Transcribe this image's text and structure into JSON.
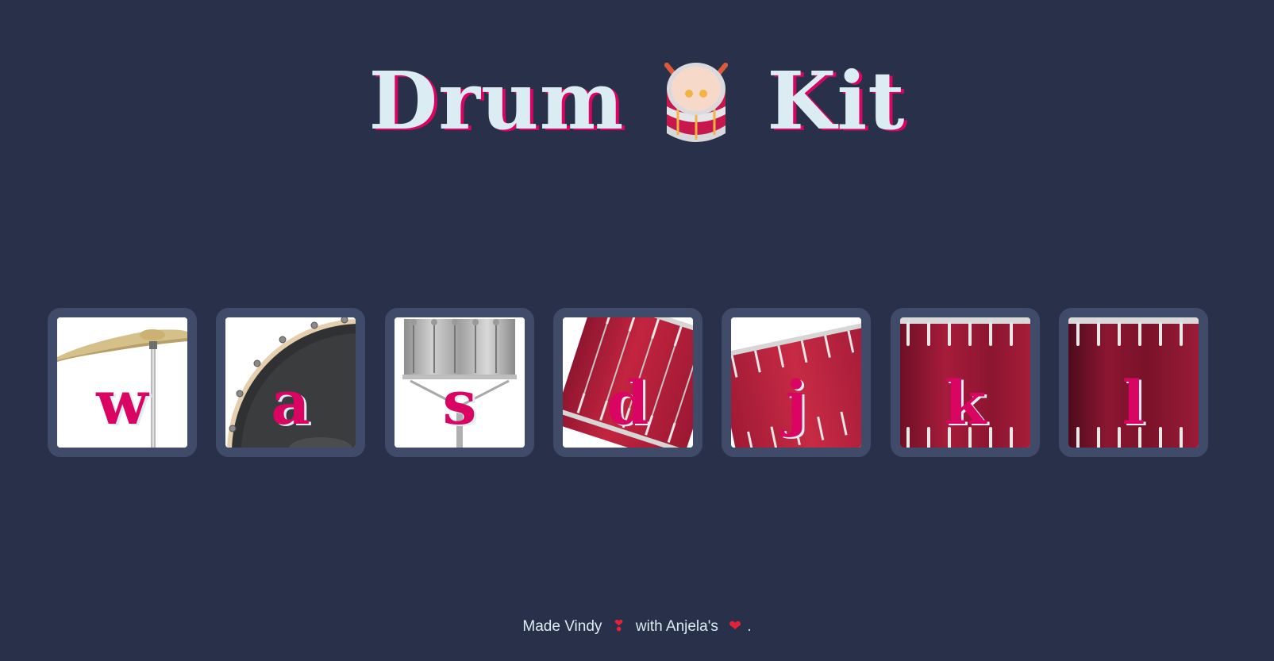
{
  "header": {
    "title_left": "Drum",
    "title_right": "Kit",
    "emoji_icon": "drum-icon"
  },
  "drums": [
    {
      "key": "w",
      "art": "crash-cymbal"
    },
    {
      "key": "a",
      "art": "kick-bass-drum"
    },
    {
      "key": "s",
      "art": "snare-drum"
    },
    {
      "key": "d",
      "art": "tom-1"
    },
    {
      "key": "j",
      "art": "tom-2"
    },
    {
      "key": "k",
      "art": "tom-3"
    },
    {
      "key": "l",
      "art": "tom-4"
    }
  ],
  "footer": {
    "part1": "Made Vindy",
    "part2": "with Anjela's",
    "part3": ".",
    "icon1": "heart-exclamation-icon",
    "icon2": "heart-icon"
  },
  "colors": {
    "background": "#283149",
    "tile_border": "#404b69",
    "accent": "#da0463",
    "text": "#dbedf3"
  }
}
